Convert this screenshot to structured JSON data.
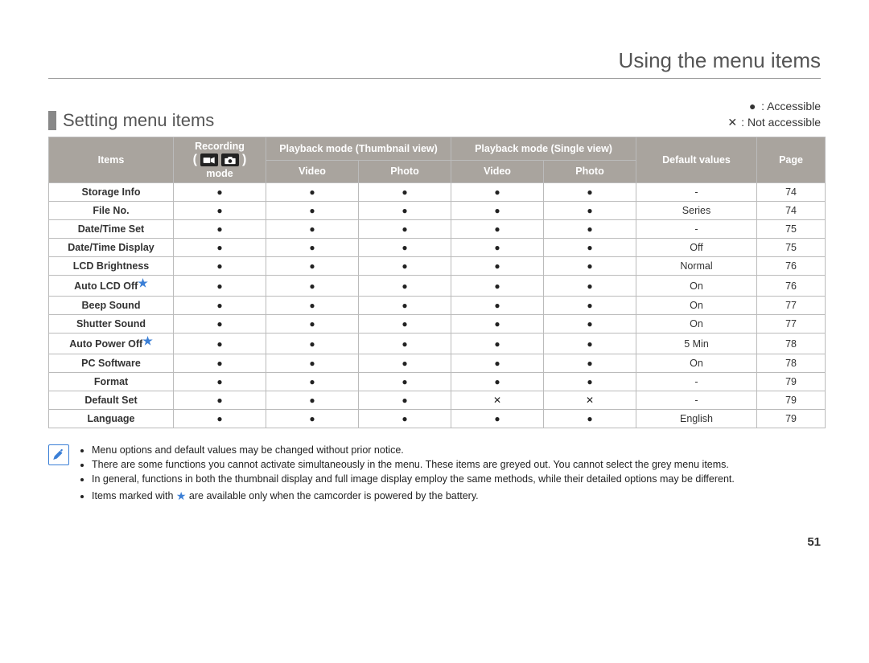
{
  "header": {
    "title": "Using the menu items"
  },
  "section": {
    "title": "Setting menu items"
  },
  "legend": {
    "accessible_label": "Accessible",
    "not_accessible_label": "Not accessible"
  },
  "table": {
    "headers": {
      "items": "Items",
      "recording_top": "Recording",
      "mode_bottom": "mode",
      "thumbnail": "Playback mode (Thumbnail view)",
      "single": "Playback mode (Single view)",
      "video": "Video",
      "photo": "Photo",
      "defaults": "Default values",
      "page": "Page"
    },
    "rows": [
      {
        "name": "Storage Info",
        "star": false,
        "marks": [
          "dot",
          "dot",
          "dot",
          "dot",
          "dot"
        ],
        "default": "-",
        "page": "74"
      },
      {
        "name": "File No.",
        "star": false,
        "marks": [
          "dot",
          "dot",
          "dot",
          "dot",
          "dot"
        ],
        "default": "Series",
        "page": "74"
      },
      {
        "name": "Date/Time Set",
        "star": false,
        "marks": [
          "dot",
          "dot",
          "dot",
          "dot",
          "dot"
        ],
        "default": "-",
        "page": "75"
      },
      {
        "name": "Date/Time Display",
        "star": false,
        "marks": [
          "dot",
          "dot",
          "dot",
          "dot",
          "dot"
        ],
        "default": "Off",
        "page": "75"
      },
      {
        "name": "LCD Brightness",
        "star": false,
        "marks": [
          "dot",
          "dot",
          "dot",
          "dot",
          "dot"
        ],
        "default": "Normal",
        "page": "76"
      },
      {
        "name": "Auto LCD Off",
        "star": true,
        "marks": [
          "dot",
          "dot",
          "dot",
          "dot",
          "dot"
        ],
        "default": "On",
        "page": "76"
      },
      {
        "name": "Beep Sound",
        "star": false,
        "marks": [
          "dot",
          "dot",
          "dot",
          "dot",
          "dot"
        ],
        "default": "On",
        "page": "77"
      },
      {
        "name": "Shutter Sound",
        "star": false,
        "marks": [
          "dot",
          "dot",
          "dot",
          "dot",
          "dot"
        ],
        "default": "On",
        "page": "77"
      },
      {
        "name": "Auto Power Off",
        "star": true,
        "marks": [
          "dot",
          "dot",
          "dot",
          "dot",
          "dot"
        ],
        "default": "5 Min",
        "page": "78"
      },
      {
        "name": "PC Software",
        "star": false,
        "marks": [
          "dot",
          "dot",
          "dot",
          "dot",
          "dot"
        ],
        "default": "On",
        "page": "78"
      },
      {
        "name": "Format",
        "star": false,
        "marks": [
          "dot",
          "dot",
          "dot",
          "dot",
          "dot"
        ],
        "default": "-",
        "page": "79"
      },
      {
        "name": "Default Set",
        "star": false,
        "marks": [
          "dot",
          "dot",
          "dot",
          "x",
          "x"
        ],
        "default": "-",
        "page": "79"
      },
      {
        "name": "Language",
        "star": false,
        "marks": [
          "dot",
          "dot",
          "dot",
          "dot",
          "dot"
        ],
        "default": "English",
        "page": "79"
      }
    ]
  },
  "notes": {
    "items": [
      "Menu options and default values may be changed without prior notice.",
      "There are some functions you cannot activate simultaneously in the menu. These items are greyed out. You cannot select the grey menu items.",
      "In general, functions in both the thumbnail display and full image display employ the same methods, while their detailed options may be different.",
      "Items marked with ★ are available only when the camcorder is powered by the battery."
    ]
  },
  "page_number": "51"
}
